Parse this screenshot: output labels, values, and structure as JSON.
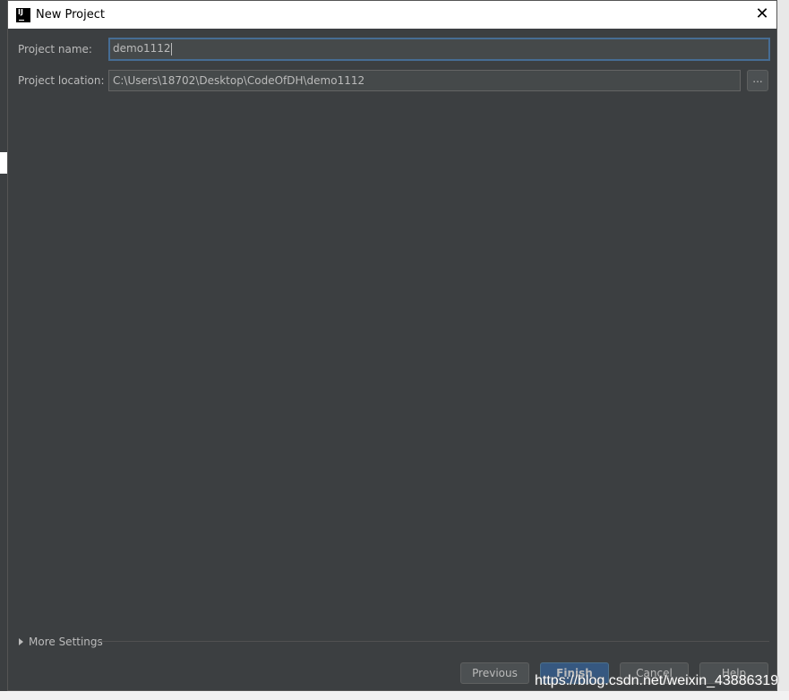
{
  "window": {
    "title": "New Project",
    "app_icon": "IJ",
    "close_icon": "close-icon"
  },
  "form": {
    "project_name": {
      "label": "Project name:",
      "value": "demo1112"
    },
    "project_location": {
      "label": "Project location:",
      "value": "C:\\Users\\18702\\Desktop\\CodeOfDH\\demo1112",
      "browse_label": "..."
    }
  },
  "more_settings": {
    "label": "More Settings"
  },
  "buttons": {
    "previous": "Previous",
    "finish": "Finish",
    "cancel": "Cancel",
    "help": "Help"
  },
  "watermark": "https://blog.csdn.net/weixin_43886319",
  "colors": {
    "background": "#3c3f41",
    "primary_button": "#365880",
    "focus_border": "#466d94"
  }
}
